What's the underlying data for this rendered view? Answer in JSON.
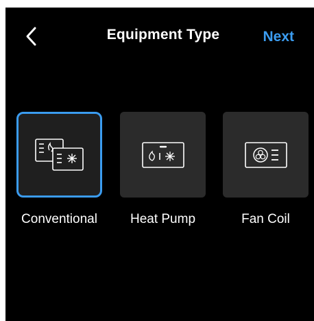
{
  "header": {
    "title": "Equipment Type",
    "next_label": "Next",
    "back_icon": "chevron-left-icon"
  },
  "options": [
    {
      "label": "Conventional",
      "icon": "conventional-equipment-icon",
      "selected": true
    },
    {
      "label": "Heat Pump",
      "icon": "heat-pump-icon",
      "selected": false
    },
    {
      "label": "Fan Coil",
      "icon": "fan-coil-icon",
      "selected": false
    }
  ],
  "colors": {
    "accent": "#3b9cf0",
    "background": "#000000",
    "tile": "#2b2b2b",
    "text": "#ffffff"
  }
}
